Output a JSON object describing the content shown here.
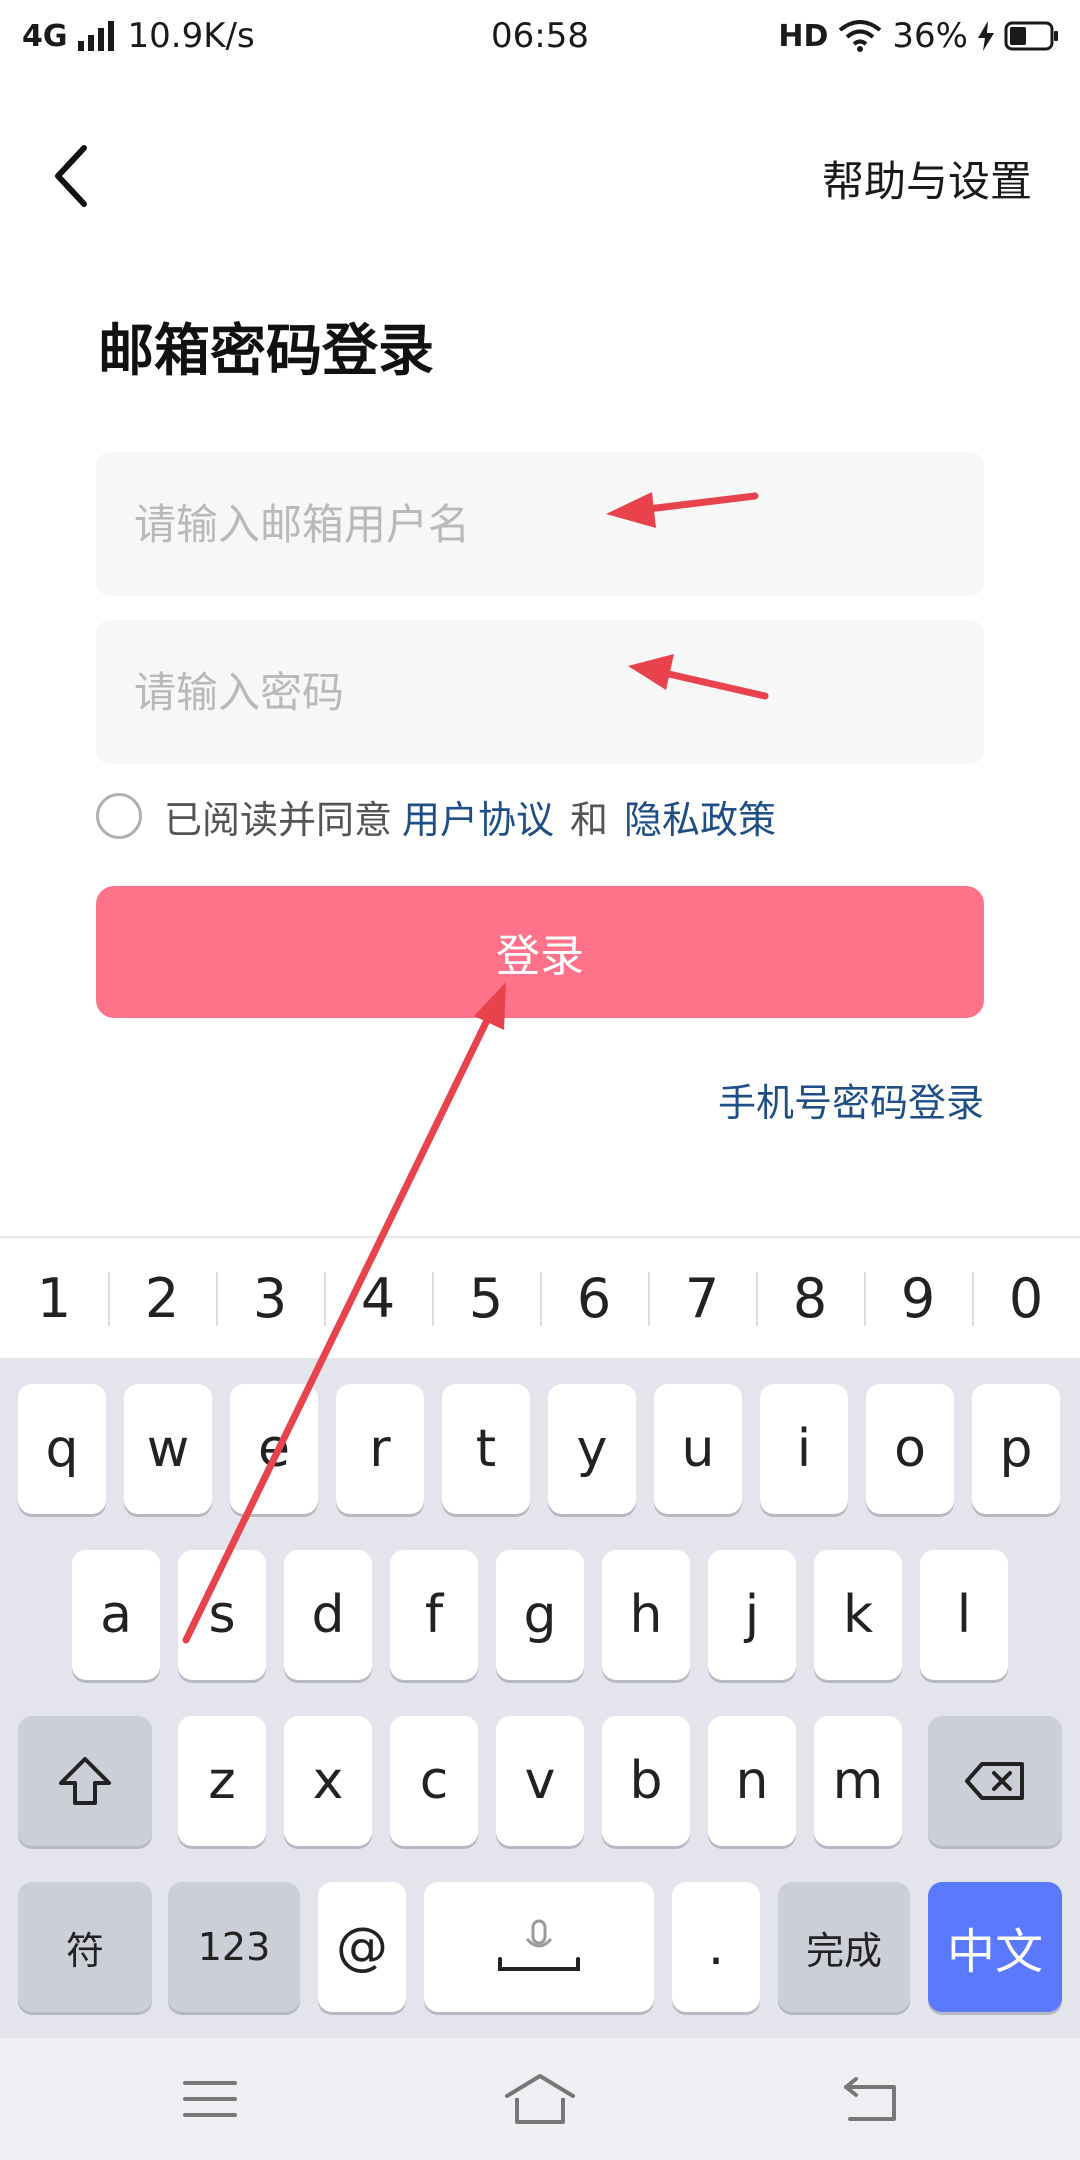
{
  "status_bar": {
    "network": "4G",
    "speed": "10.9K/s",
    "time": "06:58",
    "hd": "HD",
    "battery": "36%"
  },
  "header": {
    "back_icon": "chevron-left-icon",
    "help_settings": "帮助与设置"
  },
  "page": {
    "title": "邮箱密码登录"
  },
  "form": {
    "email_placeholder": "请输入邮箱用户名",
    "email_value": "",
    "password_placeholder": "请输入密码",
    "password_value": "",
    "agreement": {
      "checked": false,
      "prefix": "已阅读并同意",
      "user_agreement": "用户协议",
      "and": "和",
      "privacy_policy": "隐私政策"
    },
    "login_button": "登录",
    "phone_login_link": "手机号密码登录"
  },
  "keyboard": {
    "number_row": [
      "1",
      "2",
      "3",
      "4",
      "5",
      "6",
      "7",
      "8",
      "9",
      "0"
    ],
    "row1": [
      "q",
      "w",
      "e",
      "r",
      "t",
      "y",
      "u",
      "i",
      "o",
      "p"
    ],
    "row2": [
      "a",
      "s",
      "d",
      "f",
      "g",
      "h",
      "j",
      "k",
      "l"
    ],
    "row3": [
      "z",
      "x",
      "c",
      "v",
      "b",
      "n",
      "m"
    ],
    "shift_icon": "shift-arrow-icon",
    "backspace_icon": "backspace-icon",
    "symbol_key": "符",
    "num_key": "123",
    "at_key": "@",
    "space_icon": "microphone-space-icon",
    "dot_key": ".",
    "done_key": "完成",
    "lang_key": "中文"
  },
  "nav_bar": {
    "menu_icon": "menu-icon",
    "home_icon": "home-icon",
    "back_icon": "back-return-icon"
  },
  "colors": {
    "login_button": "#ff728a",
    "link": "#1f4f86",
    "lang_key": "#5a79ff",
    "annotation_arrow": "#e8434d"
  }
}
